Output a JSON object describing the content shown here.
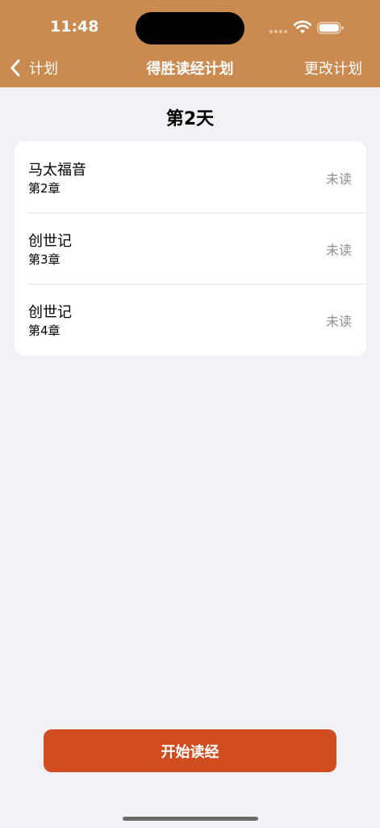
{
  "status_bar": {
    "time": "11:48"
  },
  "nav": {
    "back_label": "计划",
    "title": "得胜读经计划",
    "action_label": "更改计划"
  },
  "day_title": "第2天",
  "readings": [
    {
      "book": "马太福音",
      "chapter": "第2章",
      "status": "未读"
    },
    {
      "book": "创世记",
      "chapter": "第3章",
      "status": "未读"
    },
    {
      "book": "创世记",
      "chapter": "第4章",
      "status": "未读"
    }
  ],
  "start_button_label": "开始读经",
  "colors": {
    "header": "#ca8a50",
    "button": "#d04d20",
    "background": "#f2f1f6"
  },
  "icons": [
    "wifi-icon",
    "battery-icon",
    "chevron-left-icon"
  ]
}
